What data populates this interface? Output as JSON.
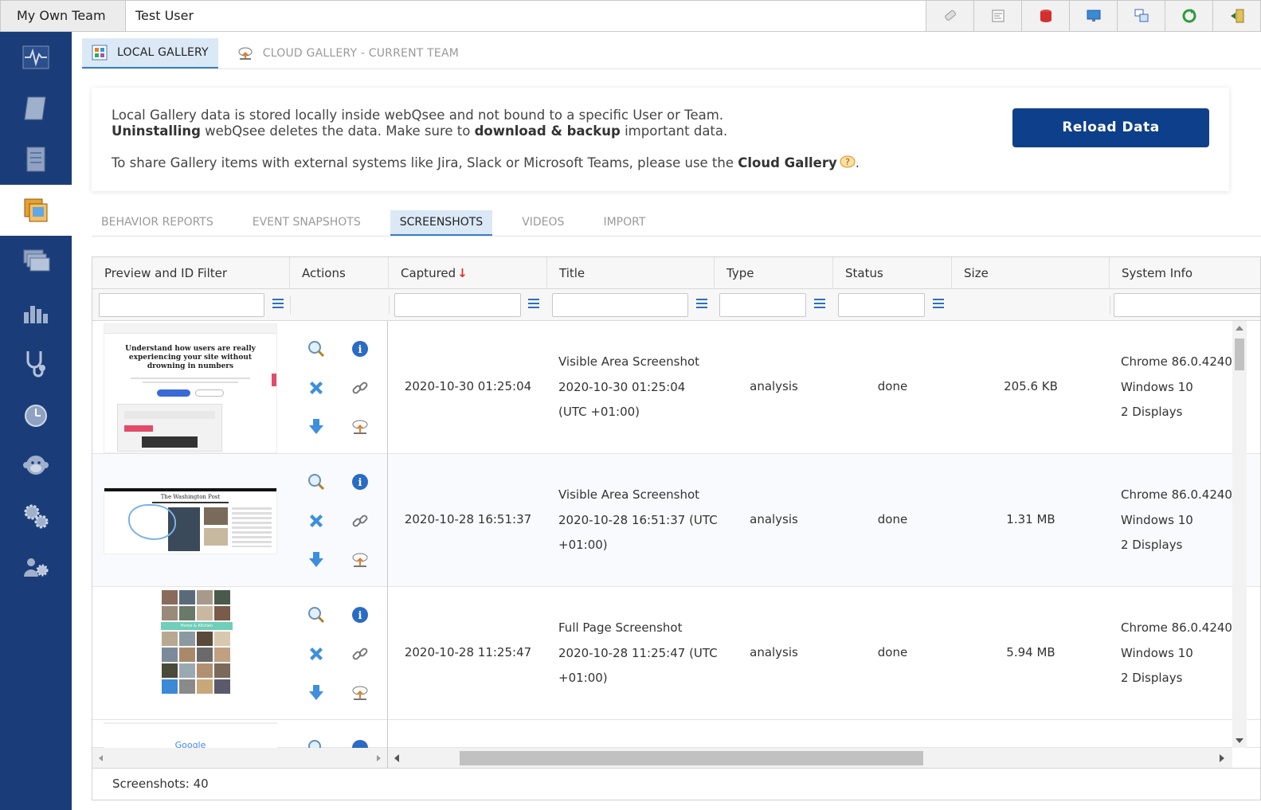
{
  "topbar": {
    "team": "My Own Team",
    "user": "Test User",
    "icons": [
      "eraser-icon",
      "report-icon",
      "database-icon",
      "monitor-icon",
      "windows-icon",
      "refresh-icon",
      "logout-icon"
    ]
  },
  "sidebar": {
    "items": [
      "pulse-icon",
      "scroll-icon",
      "notebook-icon",
      "gallery-icon",
      "layers-icon",
      "bar-chart-icon",
      "stethoscope-icon",
      "timer-icon",
      "monkey-icon",
      "gears-icon",
      "team-settings-icon"
    ],
    "active_index": 3
  },
  "gallery_tabs": {
    "local": "LOCAL GALLERY",
    "cloud": "CLOUD GALLERY - CURRENT TEAM"
  },
  "info": {
    "line1": "Local Gallery data is stored locally inside webQsee and not bound to a specific User or Team.",
    "line2_b1": "Uninstalling",
    "line2_t1": " webQsee deletes the data. Make sure to ",
    "line2_b2": "download & backup",
    "line2_t2": " important data.",
    "line3_t1": "To share Gallery items with external systems like Jira, Slack or Microsoft Teams, please use the ",
    "line3_b1": "Cloud Gallery",
    "line3_t2": ".",
    "reload_label": "Reload Data"
  },
  "subtabs": [
    "BEHAVIOR REPORTS",
    "EVENT SNAPSHOTS",
    "SCREENSHOTS",
    "VIDEOS",
    "IMPORT"
  ],
  "grid": {
    "columns": [
      "Preview and ID Filter",
      "Actions",
      "Captured",
      "Title",
      "Type",
      "Status",
      "Size",
      "System Info"
    ],
    "sort_arrow": "↓",
    "rows": [
      {
        "captured": "2020-10-30 01:25:04",
        "title": [
          "Visible Area Screenshot",
          "2020-10-30 01:25:04",
          "(UTC +01:00)"
        ],
        "type": "analysis",
        "status": "done",
        "size": "205.6 KB",
        "sys": [
          "Chrome 86.0.4240.",
          "Windows 10",
          "2 Displays"
        ],
        "thumb_title": "Understand how users are really experiencing your site without drowning in numbers"
      },
      {
        "captured": "2020-10-28 16:51:37",
        "title": [
          "Visible Area Screenshot",
          "2020-10-28 16:51:37 (UTC",
          "+01:00)"
        ],
        "type": "analysis",
        "status": "done",
        "size": "1.31 MB",
        "sys": [
          "Chrome 86.0.4240.",
          "Windows 10",
          "2 Displays"
        ],
        "thumb_title": "The Washington Post"
      },
      {
        "captured": "2020-10-28 11:25:47",
        "title": [
          "Full Page Screenshot",
          "2020-10-28 11:25:47 (UTC",
          "+01:00)"
        ],
        "type": "analysis",
        "status": "done",
        "size": "5.94 MB",
        "sys": [
          "Chrome 86.0.4240.",
          "Windows 10",
          "2 Displays"
        ],
        "thumb_title": "Home & Kitchen"
      }
    ],
    "partial_thumb": "Google"
  },
  "footer": {
    "label": "Screenshots:",
    "count": "40"
  }
}
